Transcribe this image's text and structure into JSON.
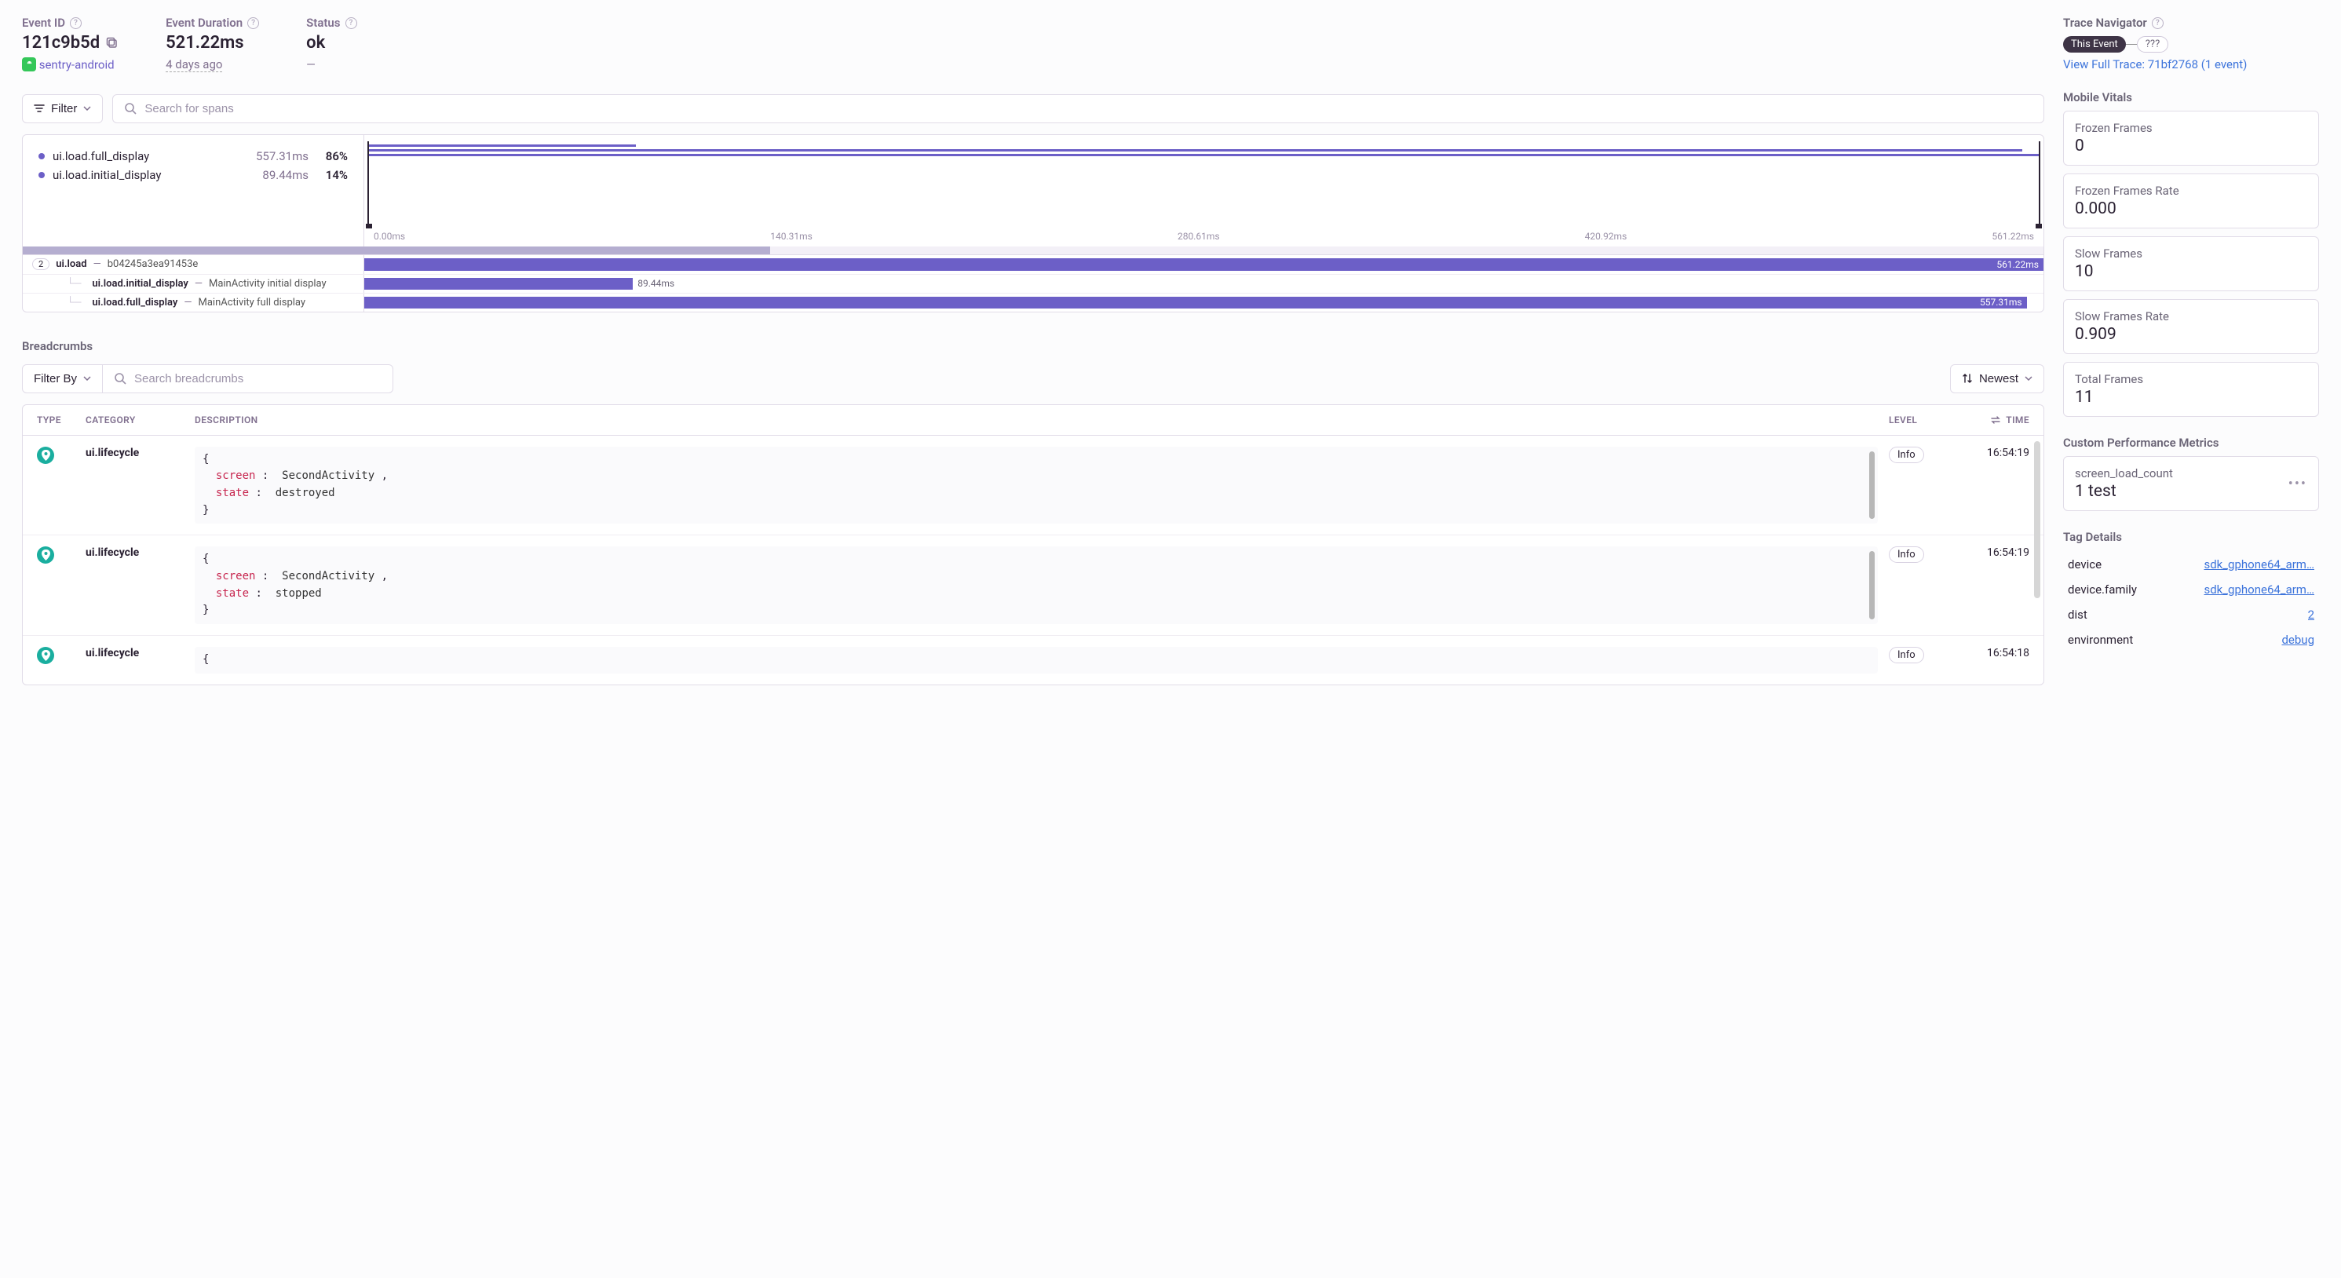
{
  "header": {
    "eventIdLabel": "Event ID",
    "eventId": "121c9b5d",
    "projectName": "sentry-android",
    "durationLabel": "Event Duration",
    "duration": "521.22ms",
    "durationSub": "4 days ago",
    "statusLabel": "Status",
    "status": "ok",
    "statusSub": "—"
  },
  "traceNav": {
    "title": "Trace Navigator",
    "thisEvent": "This Event",
    "unknown": "???",
    "viewFull": "View Full Trace: 71bf2768 (1 event)"
  },
  "toolbar": {
    "filter": "Filter",
    "searchPlaceholder": "Search for spans"
  },
  "timeline": {
    "rows": [
      {
        "name": "ui.load.full_display",
        "ms": "557.31ms",
        "pct": "86%"
      },
      {
        "name": "ui.load.initial_display",
        "ms": "89.44ms",
        "pct": "14%"
      }
    ],
    "ticks": [
      "0.00ms",
      "140.31ms",
      "280.61ms",
      "420.92ms",
      "561.22ms"
    ]
  },
  "spans": [
    {
      "count": "2",
      "op": "ui.load",
      "desc": "b04245a3ea91453e",
      "startPct": 0,
      "widthPct": 100,
      "label": "561.22ms",
      "labelInside": true,
      "indent": 0
    },
    {
      "op": "ui.load.initial_display",
      "desc": "MainActivity initial display",
      "startPct": 0,
      "widthPct": 16,
      "label": "89.44ms",
      "labelInside": false,
      "indent": 1
    },
    {
      "op": "ui.load.full_display",
      "desc": "MainActivity full display",
      "startPct": 0,
      "widthPct": 99,
      "label": "557.31ms",
      "labelInside": true,
      "indent": 1
    }
  ],
  "breadcrumbs": {
    "title": "Breadcrumbs",
    "filterBy": "Filter By",
    "searchPlaceholder": "Search breadcrumbs",
    "sort": "Newest",
    "cols": {
      "type": "TYPE",
      "category": "CATEGORY",
      "description": "DESCRIPTION",
      "level": "LEVEL",
      "time": "TIME"
    },
    "rows": [
      {
        "category": "ui.lifecycle",
        "level": "Info",
        "time": "16:54:19",
        "screen": "SecondActivity",
        "state": "destroyed"
      },
      {
        "category": "ui.lifecycle",
        "level": "Info",
        "time": "16:54:19",
        "screen": "SecondActivity",
        "state": "stopped"
      },
      {
        "category": "ui.lifecycle",
        "level": "Info",
        "time": "16:54:18",
        "screen": "",
        "state": ""
      }
    ],
    "kv": {
      "screenKey": "screen",
      "stateKey": "state"
    }
  },
  "mobileVitals": {
    "title": "Mobile Vitals",
    "cards": [
      {
        "label": "Frozen Frames",
        "value": "0"
      },
      {
        "label": "Frozen Frames Rate",
        "value": "0.000"
      },
      {
        "label": "Slow Frames",
        "value": "10"
      },
      {
        "label": "Slow Frames Rate",
        "value": "0.909"
      },
      {
        "label": "Total Frames",
        "value": "11"
      }
    ]
  },
  "customMetrics": {
    "title": "Custom Performance Metrics",
    "card": {
      "label": "screen_load_count",
      "value": "1 test"
    }
  },
  "tags": {
    "title": "Tag Details",
    "rows": [
      {
        "key": "device",
        "val": "sdk_gphone64_arm…"
      },
      {
        "key": "device.family",
        "val": "sdk_gphone64_arm…"
      },
      {
        "key": "dist",
        "val": "2"
      },
      {
        "key": "environment",
        "val": "debug"
      }
    ]
  }
}
